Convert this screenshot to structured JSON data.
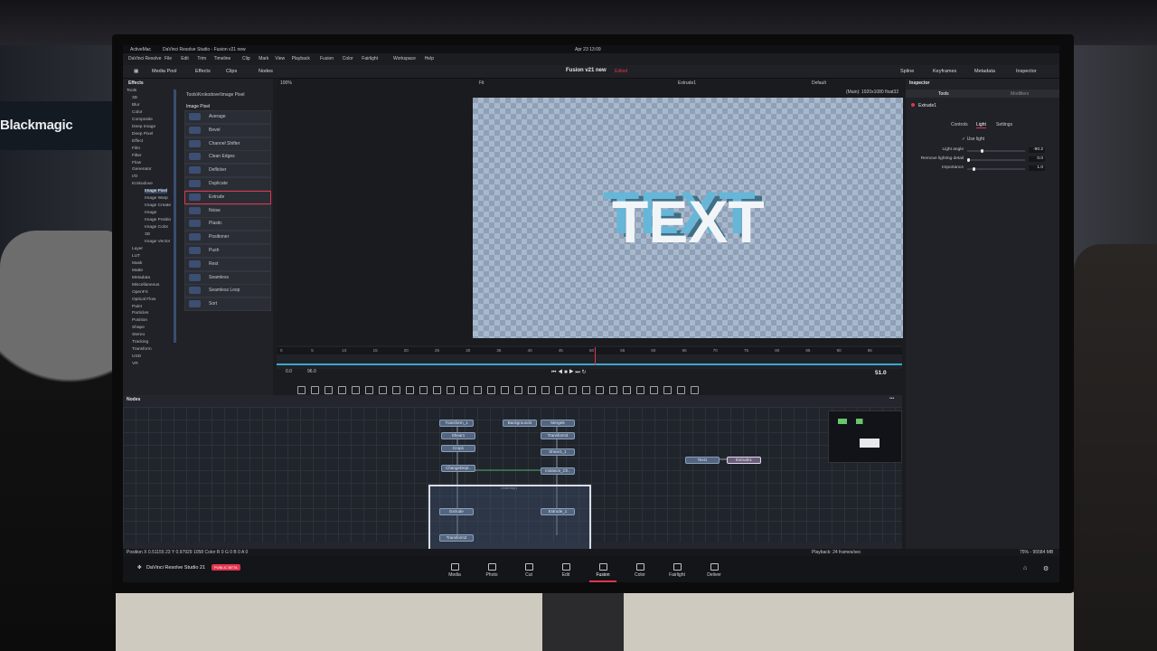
{
  "environment": {
    "sign_text": "Blackmagic"
  },
  "os_bar": {
    "app": "ActiveMac",
    "window": "DaVinci Resolve Studio - Fusion v21 new",
    "clock": "Apr 23  13:09"
  },
  "menu": [
    "DaVinci Resolve",
    "File",
    "Edit",
    "Trim",
    "Timeline",
    "Clip",
    "Mark",
    "View",
    "Playback",
    "Fusion",
    "Color",
    "Fairlight",
    "Workspace",
    "Help"
  ],
  "toolbar": {
    "left": [
      "Media Pool",
      "Effects",
      "Clips",
      "Nodes"
    ],
    "project_title": "Fusion v21 new",
    "project_status": "Edited",
    "right": [
      "Spline",
      "Keyframes",
      "Metadata",
      "Inspector"
    ]
  },
  "effects": {
    "header": "Effects",
    "tree": [
      "Tools",
      "3D",
      "Blur",
      "Color",
      "Composite",
      "Deep Image",
      "Deep Pixel",
      "Effect",
      "Film",
      "Filter",
      "Flow",
      "Generator",
      "I/O",
      "Krokodove",
      "Image Pixel",
      "Image Warp",
      "Image Create",
      "Image",
      "Image Positio",
      "Image Color",
      "3D",
      "Image Vector",
      "Layer",
      "LUT",
      "Mask",
      "Matte",
      "Metadata",
      "Miscellaneous",
      "OpenFX",
      "Optical Flow",
      "Paint",
      "Particles",
      "Position",
      "Shape",
      "Stereo",
      "Tracking",
      "Transform",
      "USD",
      "VR"
    ],
    "selected_tree_item": "Image Pixel",
    "breadcrumb": "Tools\\Krokodove\\Image Pixel",
    "section_title": "Image Pixel",
    "tools": [
      "Average",
      "Bevel",
      "Channel Shifter",
      "Clean Edges",
      "Deflicker",
      "Duplicate",
      "Extrude",
      "Noise",
      "Plastic",
      "Positioner",
      "Push",
      "Rest",
      "Seamless",
      "Seamless Loop",
      "Sort"
    ],
    "selected_tool": "Extrude"
  },
  "viewer": {
    "zoom": "100%",
    "fit": "Fit",
    "node_name": "Extrude1",
    "lut": "Default",
    "resolution": "(Main): 1920x1080 float32",
    "canvas_text": "TEXT"
  },
  "timeline": {
    "start": "0.0",
    "end": "96.0",
    "current": "51.0",
    "ticks": [
      "0",
      "5",
      "10",
      "15",
      "20",
      "25",
      "30",
      "35",
      "40",
      "45",
      "50",
      "55",
      "60",
      "65",
      "70",
      "75",
      "80",
      "85",
      "90",
      "95"
    ]
  },
  "nodes": {
    "header": "Nodes",
    "items": [
      "Transform_1",
      "Background4",
      "Merge6",
      "Shear1",
      "Transform3",
      "Crop1",
      "Shear1_1",
      "ChangeDept..",
      "Instance_Ch..",
      "Extrude",
      "Extrude_1",
      "Transform2",
      "Text1",
      "Extrude1"
    ],
    "group_label": "Underlay1",
    "selected": "Extrude1"
  },
  "inspector": {
    "header": "Inspector",
    "tabs": [
      "Tools",
      "Modifiers"
    ],
    "node": "Extrude1",
    "sub_tabs": [
      "Controls",
      "Light",
      "Settings"
    ],
    "active_sub_tab": "Light",
    "use_light_label": "Use light",
    "params": [
      {
        "label": "Light angle",
        "value": "-90.2",
        "fraction": 0.25
      },
      {
        "label": "Remove lighting detail",
        "value": "0.0",
        "fraction": 0.0
      },
      {
        "label": "Importance",
        "value": "1.0",
        "fraction": 0.1
      }
    ]
  },
  "status": {
    "position": "Position  X 0.51155  23  Y 0.97929  1058  Color R 0   G 0   B 0   A 0",
    "playback": "Playback: 24 frames/sec",
    "memory": "75% - 95584 MB"
  },
  "bottom": {
    "brand": "DaVinci Resolve Studio 21",
    "badge": "PUBLIC BETA",
    "pages": [
      "Media",
      "Photo",
      "Cut",
      "Edit",
      "Fusion",
      "Color",
      "Fairlight",
      "Deliver"
    ],
    "active_page": "Fusion"
  },
  "colors": {
    "accent": "#e2344f",
    "panel": "#202227",
    "viewer_bg": "#1a1b1f",
    "text_face": "#f2f5f8",
    "text_side": "#66b6d8"
  }
}
